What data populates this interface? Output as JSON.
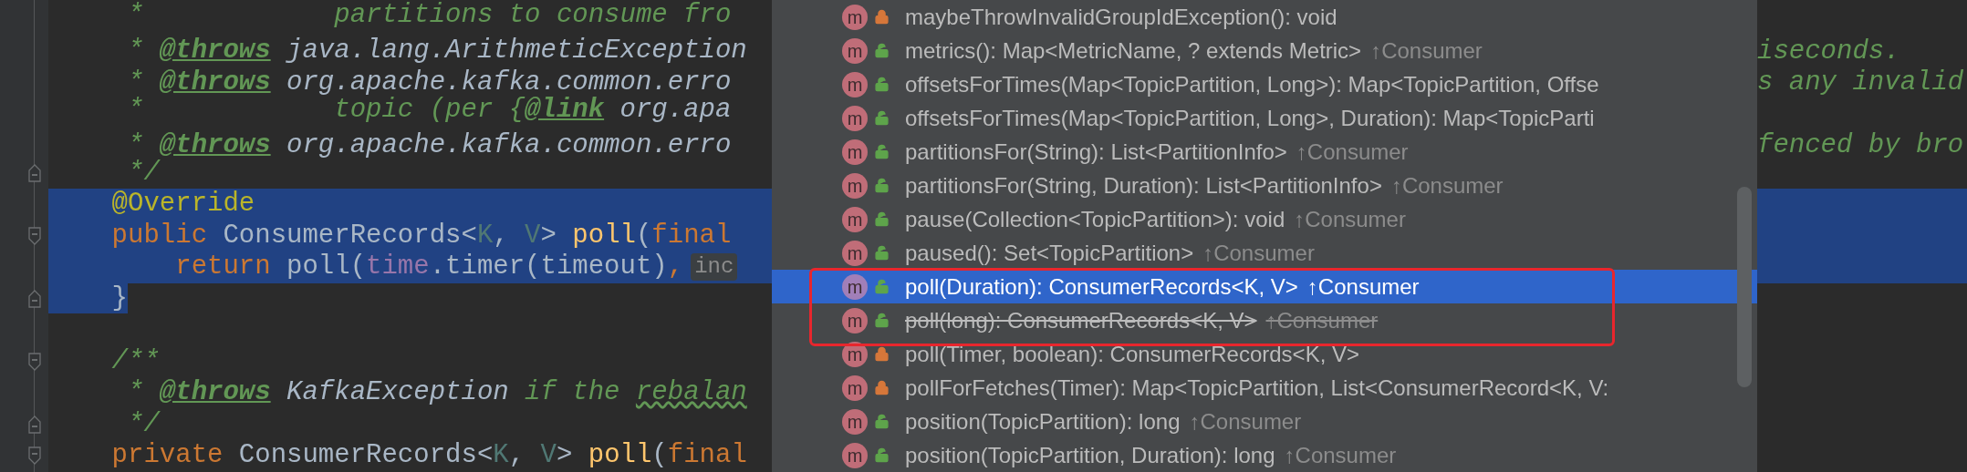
{
  "editor": {
    "lines": [
      {
        "fold_start": false,
        "fold_end": false,
        "selected": false,
        "tokens": [
          {
            "kind": "comment",
            "text": "     *            partitions to consume fro"
          }
        ]
      },
      {
        "fold_start": false,
        "fold_end": false,
        "selected": false,
        "tokens": [
          {
            "kind": "comment",
            "text": "     * "
          },
          {
            "kind": "tag",
            "text": "@throws"
          },
          {
            "kind": "ref",
            "text": " java.lang.ArithmeticException"
          }
        ],
        "right": [
          {
            "kind": "comment",
            "text": "iseconds."
          }
        ]
      },
      {
        "fold_start": false,
        "fold_end": false,
        "selected": false,
        "tokens": [
          {
            "kind": "comment",
            "text": "     * "
          },
          {
            "kind": "tag",
            "text": "@throws"
          },
          {
            "kind": "ref",
            "text": " org.apache.kafka.common.erro"
          }
        ],
        "right": [
          {
            "kind": "comment",
            "text": "s any invalid"
          }
        ]
      },
      {
        "fold_start": false,
        "fold_end": false,
        "selected": false,
        "tokens": [
          {
            "kind": "comment",
            "text": "     *            topic (per {"
          },
          {
            "kind": "tag",
            "text": "@link"
          },
          {
            "kind": "ref",
            "text": " org.apa"
          }
        ]
      },
      {
        "fold_start": false,
        "fold_end": false,
        "selected": false,
        "tokens": [
          {
            "kind": "comment",
            "text": "     * "
          },
          {
            "kind": "tag",
            "text": "@throws"
          },
          {
            "kind": "ref",
            "text": " org.apache.kafka.common.erro"
          }
        ],
        "right": [
          {
            "kind": "comment",
            "text": "fenced by bro"
          }
        ]
      },
      {
        "fold_start": false,
        "fold_end": true,
        "selected": false,
        "tokens": [
          {
            "kind": "comment",
            "text": "     */"
          }
        ]
      },
      {
        "fold_start": false,
        "fold_end": false,
        "selected": true,
        "tokens": [
          {
            "kind": "annotation",
            "text": "    @Override"
          }
        ]
      },
      {
        "fold_start": true,
        "fold_end": false,
        "selected": true,
        "tokens": [
          {
            "kind": "keyword",
            "text": "    public"
          },
          {
            "kind": "plain",
            "text": " ConsumerRecords<"
          },
          {
            "kind": "typeparam",
            "text": "K"
          },
          {
            "kind": "plain",
            "text": ", "
          },
          {
            "kind": "typeparam",
            "text": "V"
          },
          {
            "kind": "plain",
            "text": "> "
          },
          {
            "kind": "method",
            "text": "poll"
          },
          {
            "kind": "plain",
            "text": "("
          },
          {
            "kind": "keyword",
            "text": "final"
          }
        ]
      },
      {
        "fold_start": false,
        "fold_end": false,
        "selected": true,
        "tokens": [
          {
            "kind": "keyword",
            "text": "        return"
          },
          {
            "kind": "plain",
            "text": " poll("
          },
          {
            "kind": "field",
            "text": "time"
          },
          {
            "kind": "plain",
            "text": ".timer(timeout)"
          },
          {
            "kind": "keyword",
            "text": ","
          }
        ],
        "hint": "inc"
      },
      {
        "fold_start": false,
        "fold_end": true,
        "selected": false,
        "tokens": [
          {
            "kind": "plain",
            "text": "    }",
            "selected": true
          }
        ]
      },
      {
        "fold_start": false,
        "fold_end": false,
        "selected": false
      },
      {
        "fold_start": true,
        "fold_end": false,
        "selected": false,
        "tokens": [
          {
            "kind": "comment",
            "text": "    /**"
          }
        ]
      },
      {
        "fold_start": false,
        "fold_end": false,
        "selected": false,
        "tokens": [
          {
            "kind": "comment",
            "text": "     * "
          },
          {
            "kind": "tag",
            "text": "@throws"
          },
          {
            "kind": "ref",
            "text": " KafkaException"
          },
          {
            "kind": "comment",
            "text": " if the "
          },
          {
            "kind": "typo",
            "text": "rebalan"
          }
        ]
      },
      {
        "fold_start": false,
        "fold_end": true,
        "selected": false,
        "tokens": [
          {
            "kind": "comment",
            "text": "     */"
          }
        ]
      },
      {
        "fold_start": true,
        "fold_end": false,
        "selected": false,
        "tokens": [
          {
            "kind": "keyword",
            "text": "    private"
          },
          {
            "kind": "plain",
            "text": " ConsumerRecords<"
          },
          {
            "kind": "typeparam",
            "text": "K"
          },
          {
            "kind": "plain",
            "text": ", "
          },
          {
            "kind": "typeparam",
            "text": "V"
          },
          {
            "kind": "plain",
            "text": "> "
          },
          {
            "kind": "method",
            "text": "poll"
          },
          {
            "kind": "plain",
            "text": "("
          },
          {
            "kind": "keyword",
            "text": "final"
          }
        ]
      }
    ]
  },
  "completion": {
    "items": [
      {
        "icon": "m",
        "private": true,
        "text": "maybeThrowInvalidGroupIdException(): void",
        "selected": false,
        "deprecated": false,
        "annotated": false
      },
      {
        "icon": "m",
        "private": false,
        "text": "metrics(): Map<MetricName, ? extends Metric>",
        "origin": "↑Consumer",
        "selected": false,
        "deprecated": false,
        "annotated": false
      },
      {
        "icon": "m",
        "private": false,
        "text": "offsetsForTimes(Map<TopicPartition, Long>): Map<TopicPartition, Offse",
        "selected": false,
        "deprecated": false,
        "annotated": false
      },
      {
        "icon": "m",
        "private": false,
        "text": "offsetsForTimes(Map<TopicPartition, Long>, Duration): Map<TopicParti",
        "selected": false,
        "deprecated": false,
        "annotated": false
      },
      {
        "icon": "m",
        "private": false,
        "text": "partitionsFor(String): List<PartitionInfo>",
        "origin": "↑Consumer",
        "selected": false,
        "deprecated": false,
        "annotated": false
      },
      {
        "icon": "m",
        "private": false,
        "text": "partitionsFor(String, Duration): List<PartitionInfo>",
        "origin": "↑Consumer",
        "selected": false,
        "deprecated": false,
        "annotated": false
      },
      {
        "icon": "m",
        "private": false,
        "text": "pause(Collection<TopicPartition>): void",
        "origin": "↑Consumer",
        "selected": false,
        "deprecated": false,
        "annotated": false
      },
      {
        "icon": "m",
        "private": false,
        "text": "paused(): Set<TopicPartition>",
        "origin": "↑Consumer",
        "selected": false,
        "deprecated": false,
        "annotated": false
      },
      {
        "icon": "m",
        "private": false,
        "text": "poll(Duration): ConsumerRecords<K, V>",
        "origin": "↑Consumer",
        "selected": true,
        "deprecated": false,
        "annotated": true
      },
      {
        "icon": "m",
        "private": false,
        "text": "poll(long): ConsumerRecords<K, V>",
        "origin": "↑Consumer",
        "selected": false,
        "deprecated": true,
        "annotated": true
      },
      {
        "icon": "m",
        "private": true,
        "text": "poll(Timer, boolean): ConsumerRecords<K, V>",
        "selected": false,
        "deprecated": false,
        "annotated": false
      },
      {
        "icon": "m",
        "private": true,
        "text": "pollForFetches(Timer): Map<TopicPartition, List<ConsumerRecord<K, V:",
        "selected": false,
        "deprecated": false,
        "annotated": false
      },
      {
        "icon": "m",
        "private": false,
        "text": "position(TopicPartition): long",
        "origin": "↑Consumer",
        "selected": false,
        "deprecated": false,
        "annotated": false
      },
      {
        "icon": "m",
        "private": false,
        "text": "position(TopicPartition, Duration): long",
        "origin": "↑Consumer",
        "selected": false,
        "deprecated": false,
        "annotated": false
      }
    ]
  }
}
